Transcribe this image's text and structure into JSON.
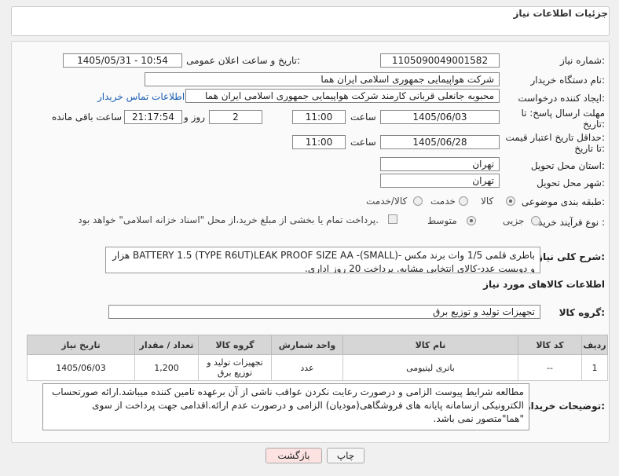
{
  "header": {
    "title": "جزئیات اطلاعات نیاز"
  },
  "fields": {
    "need_number_label": "شماره نیاز:",
    "need_number": "1105090049001582",
    "announce_label": "تاریخ و ساعت اعلان عمومی:",
    "announce_value": "1405/05/31 - 10:54",
    "buyer_label": "نام دستگاه خریدار:",
    "buyer_value": "شرکت هواپیمایی جمهوری اسلامی ایران هما",
    "creator_label": "ایجاد کننده درخواست:",
    "creator_value": "محبوبه جانعلی قربانی کارمند شرکت هواپیمایی جمهوری اسلامی ایران هما",
    "contact_link": "اطلاعات تماس خریدار",
    "deadline_label_1": "مهلت ارسال پاسخ: تا",
    "deadline_label_2": "تاریخ:",
    "deadline_date": "1405/06/03",
    "time_label": "ساعت",
    "deadline_time": "11:00",
    "days_value": "2",
    "days_label": "روز و",
    "remaining_value": "21:17:54",
    "remaining_label": "ساعت باقی مانده",
    "validity_label_1": "حداقل تاریخ اعتبار قیمت:",
    "validity_label_2": "تا تاریخ:",
    "validity_date": "1405/06/28",
    "validity_time": "11:00",
    "province_label": "استان محل تحویل:",
    "province_value": "تهران",
    "city_label": "شهر محل تحویل:",
    "city_value": "تهران",
    "category_label": "طبقه بندی موضوعی:",
    "category_options": [
      "کالا",
      "خدمت",
      "کالا/خدمت"
    ],
    "category_selected": "کالا",
    "process_label": "نوع فرآیند خرید :",
    "process_options": [
      "جزیی",
      "متوسط"
    ],
    "process_selected": "متوسط",
    "treasury_text": "پرداخت تمام یا بخشی از مبلغ خرید،از محل \"اسناد خزانه اسلامی\" خواهد بود."
  },
  "description": {
    "label": "شرح کلی نیاز:",
    "text": "باطری قلمی 1/5 وات برند مکس -(SMALL)- BATTERY 1.5 (TYPE R6UT)LEAK PROOF SIZE AA هزار و دویست عدد-کالای انتخابی مشابه. پرداخت 20 روز اداری."
  },
  "goods_info": {
    "title": "اطلاعات کالاهای مورد نیاز",
    "group_label": "گروه کالا:",
    "group_value": "تجهیزات تولید و توزیع برق"
  },
  "table": {
    "headers": [
      "ردیف",
      "کد کالا",
      "نام کالا",
      "واحد شمارش",
      "گروه کالا",
      "تعداد / مقدار",
      "تاریخ نیاز"
    ],
    "rows": [
      [
        "1",
        "--",
        "باتری لیتیومی",
        "عدد",
        "تجهیزات تولید و توزیع برق",
        "1,200",
        "1405/06/03"
      ]
    ]
  },
  "buyer_notes": {
    "label": "توضیحات خریدار:",
    "text": "مطالعه شرایط پیوست الزامی و درصورت رعایت نکردن عواقب ناشی از آن برعهده تامین کننده میباشد.ارائه صورتحساب الکترونیکی ازسامانه پایانه های فروشگاهی(مودیان) الزامی و درصورت عدم ارائه.اقدامی جهت پرداخت از سوی \"هما\"متصور نمی باشد."
  },
  "buttons": {
    "print": "چاپ",
    "back": "بازگشت"
  },
  "colors": {
    "accent_link": "#1a5fb4",
    "back_button_bg": "#fde2e2"
  }
}
